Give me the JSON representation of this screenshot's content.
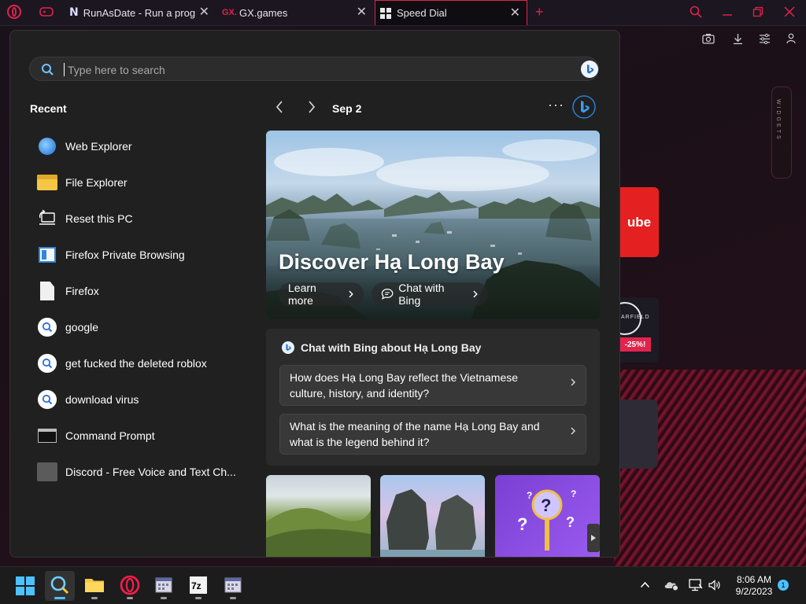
{
  "browser": {
    "tabs": [
      {
        "label": "RunAsDate - Run a program",
        "favicon_text": "N"
      },
      {
        "label": "GX.games",
        "favicon_text": "GX."
      },
      {
        "label": "Speed Dial",
        "active": true
      }
    ],
    "close_glyph": "✕",
    "new_tab_glyph": "+",
    "sidebar_widgets_label": "WIDGETS",
    "speed_dial": {
      "youtube_fragment": "ube",
      "starfield_fragment": "ARFIELD",
      "starfield_discount": "-25%!"
    },
    "accent_color": "#e0244d"
  },
  "start_menu": {
    "search": {
      "placeholder": "Type here to search",
      "value": ""
    },
    "recent": {
      "title": "Recent",
      "items": [
        {
          "label": "Web Explorer",
          "icon": "web-explorer-icon"
        },
        {
          "label": "File Explorer",
          "icon": "folder-icon"
        },
        {
          "label": "Reset this PC",
          "icon": "reset-pc-icon"
        },
        {
          "label": "Firefox Private Browsing",
          "icon": "firefox-private-icon"
        },
        {
          "label": "Firefox",
          "icon": "file-icon"
        },
        {
          "label": "google",
          "icon": "web-search-icon"
        },
        {
          "label": "get fucked the deleted roblox",
          "icon": "web-search-icon"
        },
        {
          "label": "download virus",
          "icon": "web-search-icon"
        },
        {
          "label": "Command Prompt",
          "icon": "command-prompt-icon"
        },
        {
          "label": "Discord - Free Voice and Text Ch...",
          "icon": "discord-icon"
        }
      ]
    },
    "highlights": {
      "date": "Sep 2",
      "more_glyph": "···",
      "hero": {
        "title": "Discover Hạ Long Bay",
        "learn_more": "Learn more",
        "chat_with_bing": "Chat with Bing"
      },
      "bing_chat": {
        "header": "Chat with Bing about Hạ Long Bay",
        "questions": [
          "How does Hạ Long Bay reflect the Vietnamese culture, history, and identity?",
          "What is the meaning of the name Hạ Long Bay and what is the legend behind it?"
        ]
      }
    }
  },
  "taskbar": {
    "clock_time": "8:06 AM",
    "clock_date": "9/2/2023",
    "notification_count": "1",
    "accent_color": "#4cc2ff"
  }
}
